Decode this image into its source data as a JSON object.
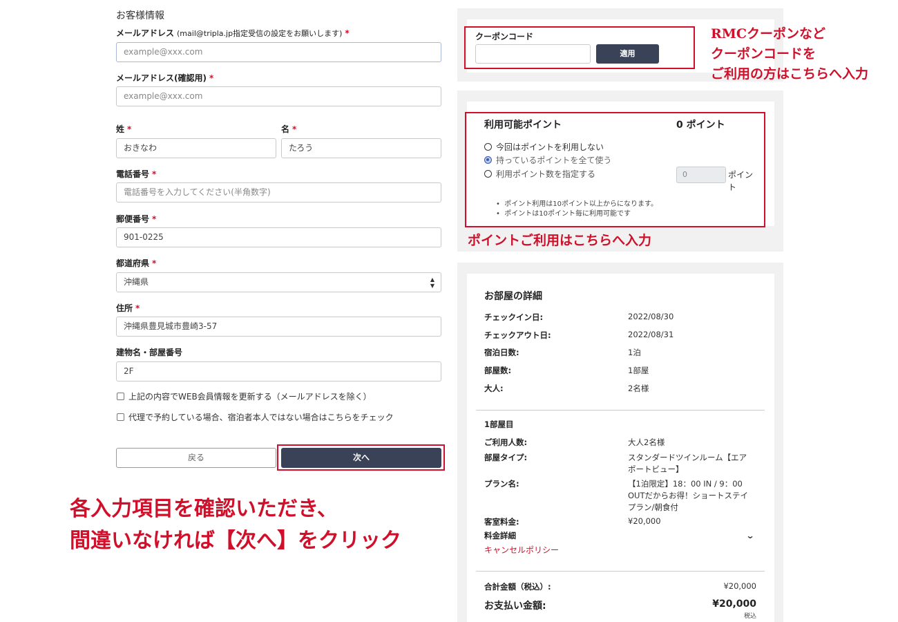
{
  "form": {
    "section_title": "お客様情報",
    "email": {
      "label": "メールアドレス",
      "note": "(mail@tripla.jp指定受信の設定をお願いします)",
      "placeholder": "example@xxx.com"
    },
    "email_confirm": {
      "label": "メールアドレス(確認用)",
      "placeholder": "example@xxx.com"
    },
    "last_name": {
      "label": "姓",
      "value": "おきなわ"
    },
    "first_name": {
      "label": "名",
      "value": "たろう"
    },
    "phone": {
      "label": "電話番号",
      "placeholder": "電話番号を入力してください(半角数字)"
    },
    "postal": {
      "label": "郵便番号",
      "value": "901-0225"
    },
    "prefecture": {
      "label": "都道府県",
      "value": "沖縄県"
    },
    "address": {
      "label": "住所",
      "value": "沖縄県豊見城市豊崎3-57"
    },
    "building": {
      "label": "建物名・部屋番号",
      "value": "2F"
    },
    "required_mark": "*",
    "check_update": "上記の内容でWEB会員情報を更新する（メールアドレスを除く）",
    "check_proxy": "代理で予約している場合、宿泊者本人ではない場合はこちらをチェック",
    "back_label": "戻る",
    "next_label": "次へ"
  },
  "coupon": {
    "label": "クーポンコード",
    "apply_label": "適用"
  },
  "points": {
    "label": "利用可能ポイント",
    "available": "0 ポイント",
    "options": [
      "今回はポイントを利用しない",
      "持っているポイントを全て使う",
      "利用ポイント数を指定する"
    ],
    "selected_index": 1,
    "input_value": "0",
    "unit": "ポイント",
    "notes": [
      "ポイント利用は10ポイント以上からになります。",
      "ポイントは10ポイント毎に利用可能です"
    ]
  },
  "room": {
    "title": "お部屋の詳細",
    "rows": [
      {
        "k": "チェックイン日:",
        "v": "2022/08/30"
      },
      {
        "k": "チェックアウト日:",
        "v": "2022/08/31"
      },
      {
        "k": "宿泊日数:",
        "v": "1泊"
      },
      {
        "k": "部屋数:",
        "v": "1部屋"
      },
      {
        "k": "大人:",
        "v": "2名様"
      }
    ],
    "room1_title": "1部屋目",
    "guests_k": "ご利用人数:",
    "guests_v": "大人2名様",
    "type_k": "部屋タイプ:",
    "type_v1": "スタンダードツインルーム【エア",
    "type_v2": "ポートビュー】",
    "plan_k": "プラン名:",
    "plan_v1": "【1泊限定】18：00 IN / 9：00",
    "plan_v2": "OUTだからお得！ショートステイ",
    "plan_v3": "プラン/朝食付",
    "fee_k": "客室料金:",
    "fee_v": "¥20,000",
    "detail_k": "料金詳細",
    "cancel_link": "キャンセルポリシー",
    "total_k": "合計金額（税込）:",
    "total_v": "¥20,000",
    "pay_k": "お支払い金額:",
    "pay_v": "¥20,000",
    "tax_note": "税込"
  },
  "annotations": {
    "coupon_1": "RMCクーポンなど",
    "coupon_2": "クーポンコードを",
    "coupon_3": "ご利用の方はこちらへ入力",
    "points": "ポイントご利用はこちらへ入力",
    "bottom_1": "各入力項目を確認いただき、",
    "bottom_2": "間違いなければ【次へ】をクリック"
  },
  "colors": {
    "accent_red": "#d0102a",
    "button_dark": "#3a4257"
  }
}
